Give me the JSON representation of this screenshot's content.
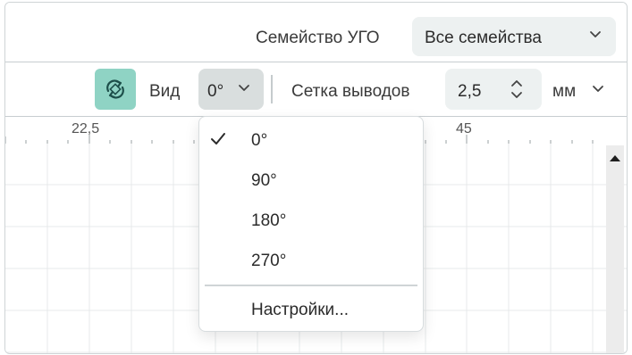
{
  "family": {
    "label": "Семейство УГО",
    "value": "Все семейства"
  },
  "toolbar": {
    "view_label": "Вид",
    "angle_value": "0°",
    "grid_label": "Сетка выводов",
    "grid_value": "2,5",
    "units": "мм"
  },
  "ruler": {
    "labels": [
      "22,5",
      "45"
    ]
  },
  "angle_menu": {
    "items": [
      {
        "label": "0°",
        "checked": true
      },
      {
        "label": "90°",
        "checked": false
      },
      {
        "label": "180°",
        "checked": false
      },
      {
        "label": "270°",
        "checked": false
      }
    ],
    "settings_label": "Настройки..."
  },
  "colors": {
    "accent_button": "#8fd3c4",
    "field_bg": "#edf1f1",
    "active_select_bg": "#d9dede",
    "grid_line": "#e7eaeb"
  },
  "icons": [
    "rotate-icon",
    "chevron-down-icon",
    "spinner-updown-icon",
    "check-icon",
    "scroll-up-arrow-icon"
  ]
}
